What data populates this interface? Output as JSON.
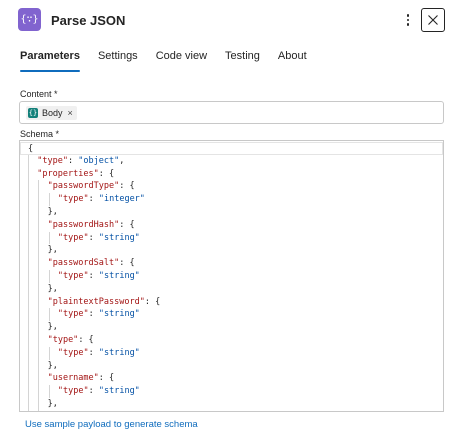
{
  "header": {
    "icon_glyph": "{∵}",
    "icon_name": "parse-json-icon",
    "title": "Parse JSON",
    "more_icon": "more-vertical-icon",
    "close_icon": "close-icon"
  },
  "tabs": [
    {
      "label": "Parameters",
      "active": true
    },
    {
      "label": "Settings",
      "active": false
    },
    {
      "label": "Code view",
      "active": false
    },
    {
      "label": "Testing",
      "active": false
    },
    {
      "label": "About",
      "active": false
    }
  ],
  "content_field": {
    "label": "Content *",
    "token": {
      "label": "Body",
      "remove": "×",
      "icon_glyph": "{}"
    }
  },
  "schema_field": {
    "label": "Schema *",
    "lines": [
      {
        "indent": 0,
        "parts": [
          [
            "p",
            "{"
          ]
        ]
      },
      {
        "indent": 1,
        "parts": [
          [
            "k",
            "\"type\""
          ],
          [
            "p",
            ": "
          ],
          [
            "s",
            "\"object\""
          ],
          [
            "p",
            ","
          ]
        ]
      },
      {
        "indent": 1,
        "parts": [
          [
            "k",
            "\"properties\""
          ],
          [
            "p",
            ": {"
          ]
        ]
      },
      {
        "indent": 2,
        "parts": [
          [
            "k",
            "\"passwordType\""
          ],
          [
            "p",
            ": {"
          ]
        ]
      },
      {
        "indent": 3,
        "parts": [
          [
            "k",
            "\"type\""
          ],
          [
            "p",
            ": "
          ],
          [
            "s",
            "\"integer\""
          ]
        ]
      },
      {
        "indent": 2,
        "parts": [
          [
            "p",
            "},"
          ]
        ]
      },
      {
        "indent": 2,
        "parts": [
          [
            "k",
            "\"passwordHash\""
          ],
          [
            "p",
            ": {"
          ]
        ]
      },
      {
        "indent": 3,
        "parts": [
          [
            "k",
            "\"type\""
          ],
          [
            "p",
            ": "
          ],
          [
            "s",
            "\"string\""
          ]
        ]
      },
      {
        "indent": 2,
        "parts": [
          [
            "p",
            "},"
          ]
        ]
      },
      {
        "indent": 2,
        "parts": [
          [
            "k",
            "\"passwordSalt\""
          ],
          [
            "p",
            ": {"
          ]
        ]
      },
      {
        "indent": 3,
        "parts": [
          [
            "k",
            "\"type\""
          ],
          [
            "p",
            ": "
          ],
          [
            "s",
            "\"string\""
          ]
        ]
      },
      {
        "indent": 2,
        "parts": [
          [
            "p",
            "},"
          ]
        ]
      },
      {
        "indent": 2,
        "parts": [
          [
            "k",
            "\"plaintextPassword\""
          ],
          [
            "p",
            ": {"
          ]
        ]
      },
      {
        "indent": 3,
        "parts": [
          [
            "k",
            "\"type\""
          ],
          [
            "p",
            ": "
          ],
          [
            "s",
            "\"string\""
          ]
        ]
      },
      {
        "indent": 2,
        "parts": [
          [
            "p",
            "},"
          ]
        ]
      },
      {
        "indent": 2,
        "parts": [
          [
            "k",
            "\"type\""
          ],
          [
            "p",
            ": {"
          ]
        ]
      },
      {
        "indent": 3,
        "parts": [
          [
            "k",
            "\"type\""
          ],
          [
            "p",
            ": "
          ],
          [
            "s",
            "\"string\""
          ]
        ]
      },
      {
        "indent": 2,
        "parts": [
          [
            "p",
            "},"
          ]
        ]
      },
      {
        "indent": 2,
        "parts": [
          [
            "k",
            "\"username\""
          ],
          [
            "p",
            ": {"
          ]
        ]
      },
      {
        "indent": 3,
        "parts": [
          [
            "k",
            "\"type\""
          ],
          [
            "p",
            ": "
          ],
          [
            "s",
            "\"string\""
          ]
        ]
      },
      {
        "indent": 2,
        "parts": [
          [
            "p",
            "},"
          ]
        ]
      }
    ]
  },
  "generate_link": "Use sample payload to generate schema",
  "colors": {
    "accent": "#0f6cbd",
    "app_icon": "#8164cf",
    "token_icon": "#13807a",
    "json_key": "#a31515",
    "json_string": "#0451a5"
  }
}
